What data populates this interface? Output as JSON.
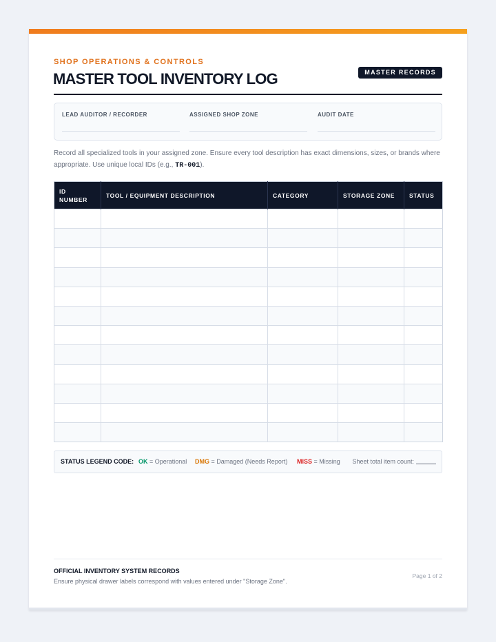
{
  "header": {
    "kicker": "SHOP OPERATIONS & CONTROLS",
    "title": "MASTER TOOL INVENTORY LOG",
    "badge": "MASTER RECORDS",
    "accent_color": "#f07c1e"
  },
  "meta_fields": [
    {
      "label": "LEAD AUDITOR / RECORDER",
      "value": ""
    },
    {
      "label": "ASSIGNED SHOP ZONE",
      "value": ""
    },
    {
      "label": "AUDIT DATE",
      "value": ""
    }
  ],
  "instructions": {
    "before_code": "Record all specialized tools in your assigned zone. Ensure every tool description has exact dimensions, sizes, or brands where appropriate. Use unique local IDs (e.g., ",
    "code": "TR-001",
    "after_code": ")."
  },
  "table": {
    "headers": [
      "ID NUMBER",
      "TOOL / EQUIPMENT DESCRIPTION",
      "CATEGORY",
      "STORAGE ZONE",
      "STATUS"
    ],
    "rows": [
      [
        "",
        "",
        "",
        "",
        ""
      ],
      [
        "",
        "",
        "",
        "",
        ""
      ],
      [
        "",
        "",
        "",
        "",
        ""
      ],
      [
        "",
        "",
        "",
        "",
        ""
      ],
      [
        "",
        "",
        "",
        "",
        ""
      ],
      [
        "",
        "",
        "",
        "",
        ""
      ],
      [
        "",
        "",
        "",
        "",
        ""
      ],
      [
        "",
        "",
        "",
        "",
        ""
      ],
      [
        "",
        "",
        "",
        "",
        ""
      ],
      [
        "",
        "",
        "",
        "",
        ""
      ],
      [
        "",
        "",
        "",
        "",
        ""
      ],
      [
        "",
        "",
        "",
        "",
        ""
      ]
    ],
    "header_color": "#0f1729"
  },
  "legend": {
    "title": "STATUS LEGEND CODE:",
    "items": [
      {
        "code": "OK",
        "label": "= Operational",
        "color": "#059669"
      },
      {
        "code": "DMG",
        "label": "= Damaged (Needs Report)",
        "color": "#d97706"
      },
      {
        "code": "MISS",
        "label": "= Missing",
        "color": "#dc2626"
      }
    ],
    "count_label": "Sheet total item count:"
  },
  "footer": {
    "title": "OFFICIAL INVENTORY SYSTEM RECORDS",
    "note": "Ensure physical drawer labels correspond with values entered under \"Storage Zone\".",
    "page": "Page 1 of 2"
  }
}
